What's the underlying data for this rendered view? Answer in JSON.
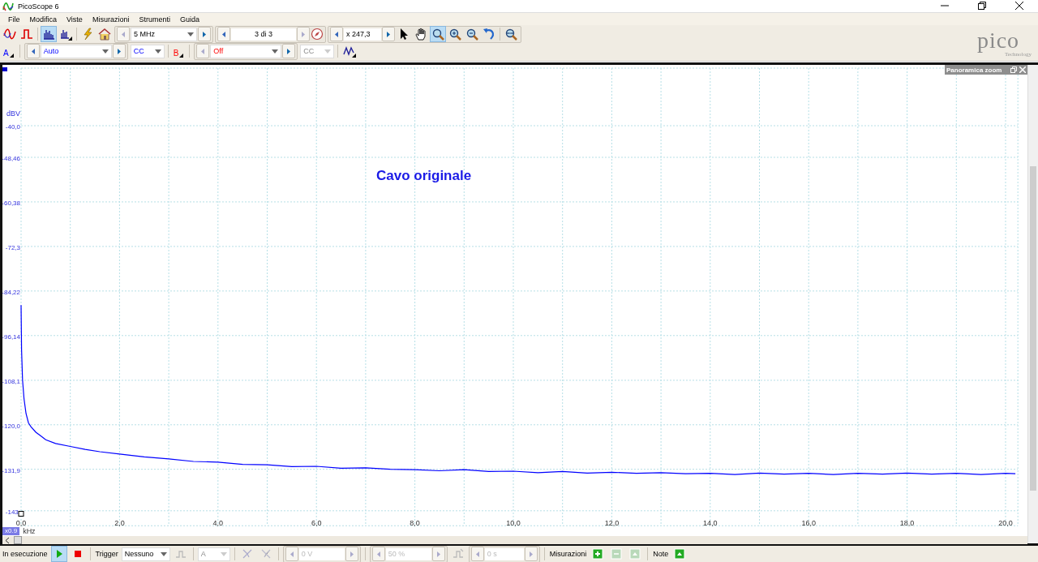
{
  "window": {
    "title": "PicoScope 6"
  },
  "menu": [
    {
      "label": "File"
    },
    {
      "label": "Modifica"
    },
    {
      "label": "Viste"
    },
    {
      "label": "Misurazioni"
    },
    {
      "label": "Strumenti"
    },
    {
      "label": "Guida"
    }
  ],
  "toolbar": {
    "view_buttons": [
      {
        "kind": "scope",
        "selected": false
      },
      {
        "kind": "persistence",
        "selected": false
      },
      {
        "kind": "spectrum",
        "selected": true
      },
      {
        "kind": "spectrum-options",
        "selected": false
      },
      {
        "kind": "probe",
        "selected": false
      },
      {
        "kind": "home",
        "selected": false
      }
    ],
    "bandwidth": "5 MHz",
    "buffer": "3 di 3",
    "zoom": "x 247,3",
    "tools": [
      {
        "kind": "pointer",
        "selected": false
      },
      {
        "kind": "hand",
        "selected": false
      },
      {
        "kind": "zoom-area",
        "selected": true
      },
      {
        "kind": "zoom-in",
        "selected": false
      },
      {
        "kind": "zoom-out",
        "selected": false
      },
      {
        "kind": "undo",
        "selected": false
      },
      {
        "kind": "zoom-fit",
        "selected": false
      }
    ]
  },
  "logo": {
    "name": "pico",
    "tagline": "Technology"
  },
  "channels": [
    {
      "letter": "A",
      "range": "Auto",
      "coupling": "CC",
      "enabled": true,
      "color": "#0000ff"
    },
    {
      "letter": "B",
      "range": "Off",
      "coupling": "CC",
      "enabled": false,
      "color": "#ff0000"
    }
  ],
  "view": {
    "panel_title": "Panoramica zoom",
    "annotation": "Cavo originale",
    "x_scale": "x0.9",
    "chart_data": {
      "type": "line",
      "grid": true,
      "xlabel": "kHz",
      "ylabel": "dBV",
      "xlim": [
        0,
        20.25
      ],
      "ylim": [
        -147,
        -24.6
      ],
      "xticks": [
        {
          "value": 0,
          "label": "0,0"
        },
        {
          "value": 2,
          "label": "2,0"
        },
        {
          "value": 4,
          "label": "4,0"
        },
        {
          "value": 6,
          "label": "6,0"
        },
        {
          "value": 8,
          "label": "8,0"
        },
        {
          "value": 10,
          "label": "10,0"
        },
        {
          "value": 12,
          "label": "12,0"
        },
        {
          "value": 14,
          "label": "14,0"
        },
        {
          "value": 16,
          "label": "16,0"
        },
        {
          "value": 18,
          "label": "18,0"
        },
        {
          "value": 20,
          "label": "20,0"
        }
      ],
      "yticks": [
        {
          "value": -40,
          "label": "-40,0"
        },
        {
          "value": -48.46,
          "label": "-48,46"
        },
        {
          "value": -60.38,
          "label": "-60,38"
        },
        {
          "value": -72.3,
          "label": "-72,3"
        },
        {
          "value": -84.22,
          "label": "-84,22"
        },
        {
          "value": -96.14,
          "label": "-96,14"
        },
        {
          "value": -108.1,
          "label": "-108,1"
        },
        {
          "value": -120,
          "label": "-120,0"
        },
        {
          "value": -131.9,
          "label": "-131,9"
        },
        {
          "value": -143,
          "label": "-143,"
        }
      ],
      "x": [
        0,
        0.01,
        0.03,
        0.06,
        0.1,
        0.15,
        0.2,
        0.3,
        0.4,
        0.5,
        0.7,
        1.0,
        1.3,
        1.6,
        2.0,
        2.5,
        3.0,
        3.5,
        4.0,
        4.5,
        5.0,
        5.5,
        6.0,
        6.5,
        7.0,
        7.5,
        8.0,
        8.5,
        9.0,
        9.5,
        10.0,
        10.5,
        11,
        11.5,
        12,
        12.5,
        13,
        13.5,
        14,
        14.5,
        15,
        15.5,
        16,
        16.5,
        17,
        17.5,
        18,
        18.5,
        19,
        19.5,
        20,
        20.2
      ],
      "series": [
        {
          "color": "#0000ff",
          "values": [
            -88,
            -100,
            -108,
            -113,
            -117,
            -119.5,
            -120.5,
            -122,
            -123,
            -124,
            -125,
            -125.8,
            -126.6,
            -127.2,
            -127.8,
            -128.6,
            -129.1,
            -129.8,
            -130.0,
            -130.6,
            -130.7,
            -131.2,
            -131.1,
            -131.6,
            -131.5,
            -131.9,
            -132.0,
            -132.3,
            -132.0,
            -132.5,
            -132.4,
            -132.8,
            -132.5,
            -132.9,
            -132.7,
            -133.0,
            -132.8,
            -133.1,
            -133.0,
            -133.3,
            -132.9,
            -133.2,
            -133.0,
            -133.3,
            -133.0,
            -133.2,
            -132.9,
            -133.2,
            -133.0,
            -133.3,
            -133.0,
            -133.1
          ]
        }
      ]
    }
  },
  "status_bar": {
    "state": "In esecuzione",
    "running": true,
    "trigger_label": "Trigger",
    "trigger_mode": "Nessuno",
    "trigger_channel": {
      "text": "A",
      "disabled": true
    },
    "threshold": {
      "text": "0 V",
      "disabled": true
    },
    "pretrigger": {
      "text": "50 %",
      "disabled": true
    },
    "delay": {
      "text": "0 s",
      "disabled": true
    },
    "measurements_label": "Misurazioni",
    "notes_label": "Note"
  }
}
